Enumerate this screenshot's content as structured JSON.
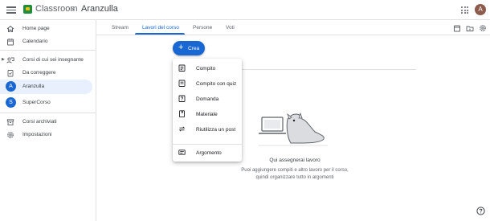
{
  "header": {
    "app_title": "Classroom",
    "breadcrumb_separator": "›",
    "class_name": "Aranzulla",
    "avatar_letter": "A"
  },
  "sidebar": {
    "items": [
      {
        "label": "Home page",
        "icon": "home-icon"
      },
      {
        "label": "Calendario",
        "icon": "calendar-icon"
      },
      {
        "label": "Corsi di cui sei insegnante",
        "icon": "teaching-icon"
      },
      {
        "label": "Da correggere",
        "icon": "to-review-icon"
      },
      {
        "label": "Aranzulla",
        "avatar": "A",
        "color": "#1967d2"
      },
      {
        "label": "SuperCorso",
        "avatar": "S",
        "color": "#1967d2"
      },
      {
        "label": "Corsi archiviati",
        "icon": "archive-icon"
      },
      {
        "label": "Impostazioni",
        "icon": "settings-icon"
      }
    ]
  },
  "tabs": [
    "Stream",
    "Lavori del corso",
    "Persone",
    "Voti"
  ],
  "create_button": {
    "label": "Crea"
  },
  "menu": {
    "items": [
      {
        "label": "Compito",
        "icon": "assignment-icon"
      },
      {
        "label": "Compito con quiz",
        "icon": "quiz-assignment-icon"
      },
      {
        "label": "Domanda",
        "icon": "question-icon"
      },
      {
        "label": "Materiale",
        "icon": "material-icon"
      },
      {
        "label": "Riutilizza un post",
        "icon": "reuse-icon"
      },
      {
        "label": "Argomento",
        "icon": "topic-icon"
      }
    ]
  },
  "empty_state": {
    "title": "Qui assegnerai lavoro",
    "description": "Puoi aggiungere compiti e altro lavoro per il corso, quindi organizzare tutto in argomenti"
  },
  "colors": {
    "accent": "#1967d2",
    "active_bg": "#e8f0fe",
    "logo_green": "#1e8e3e",
    "avatar_brown": "#8d5b4c"
  }
}
